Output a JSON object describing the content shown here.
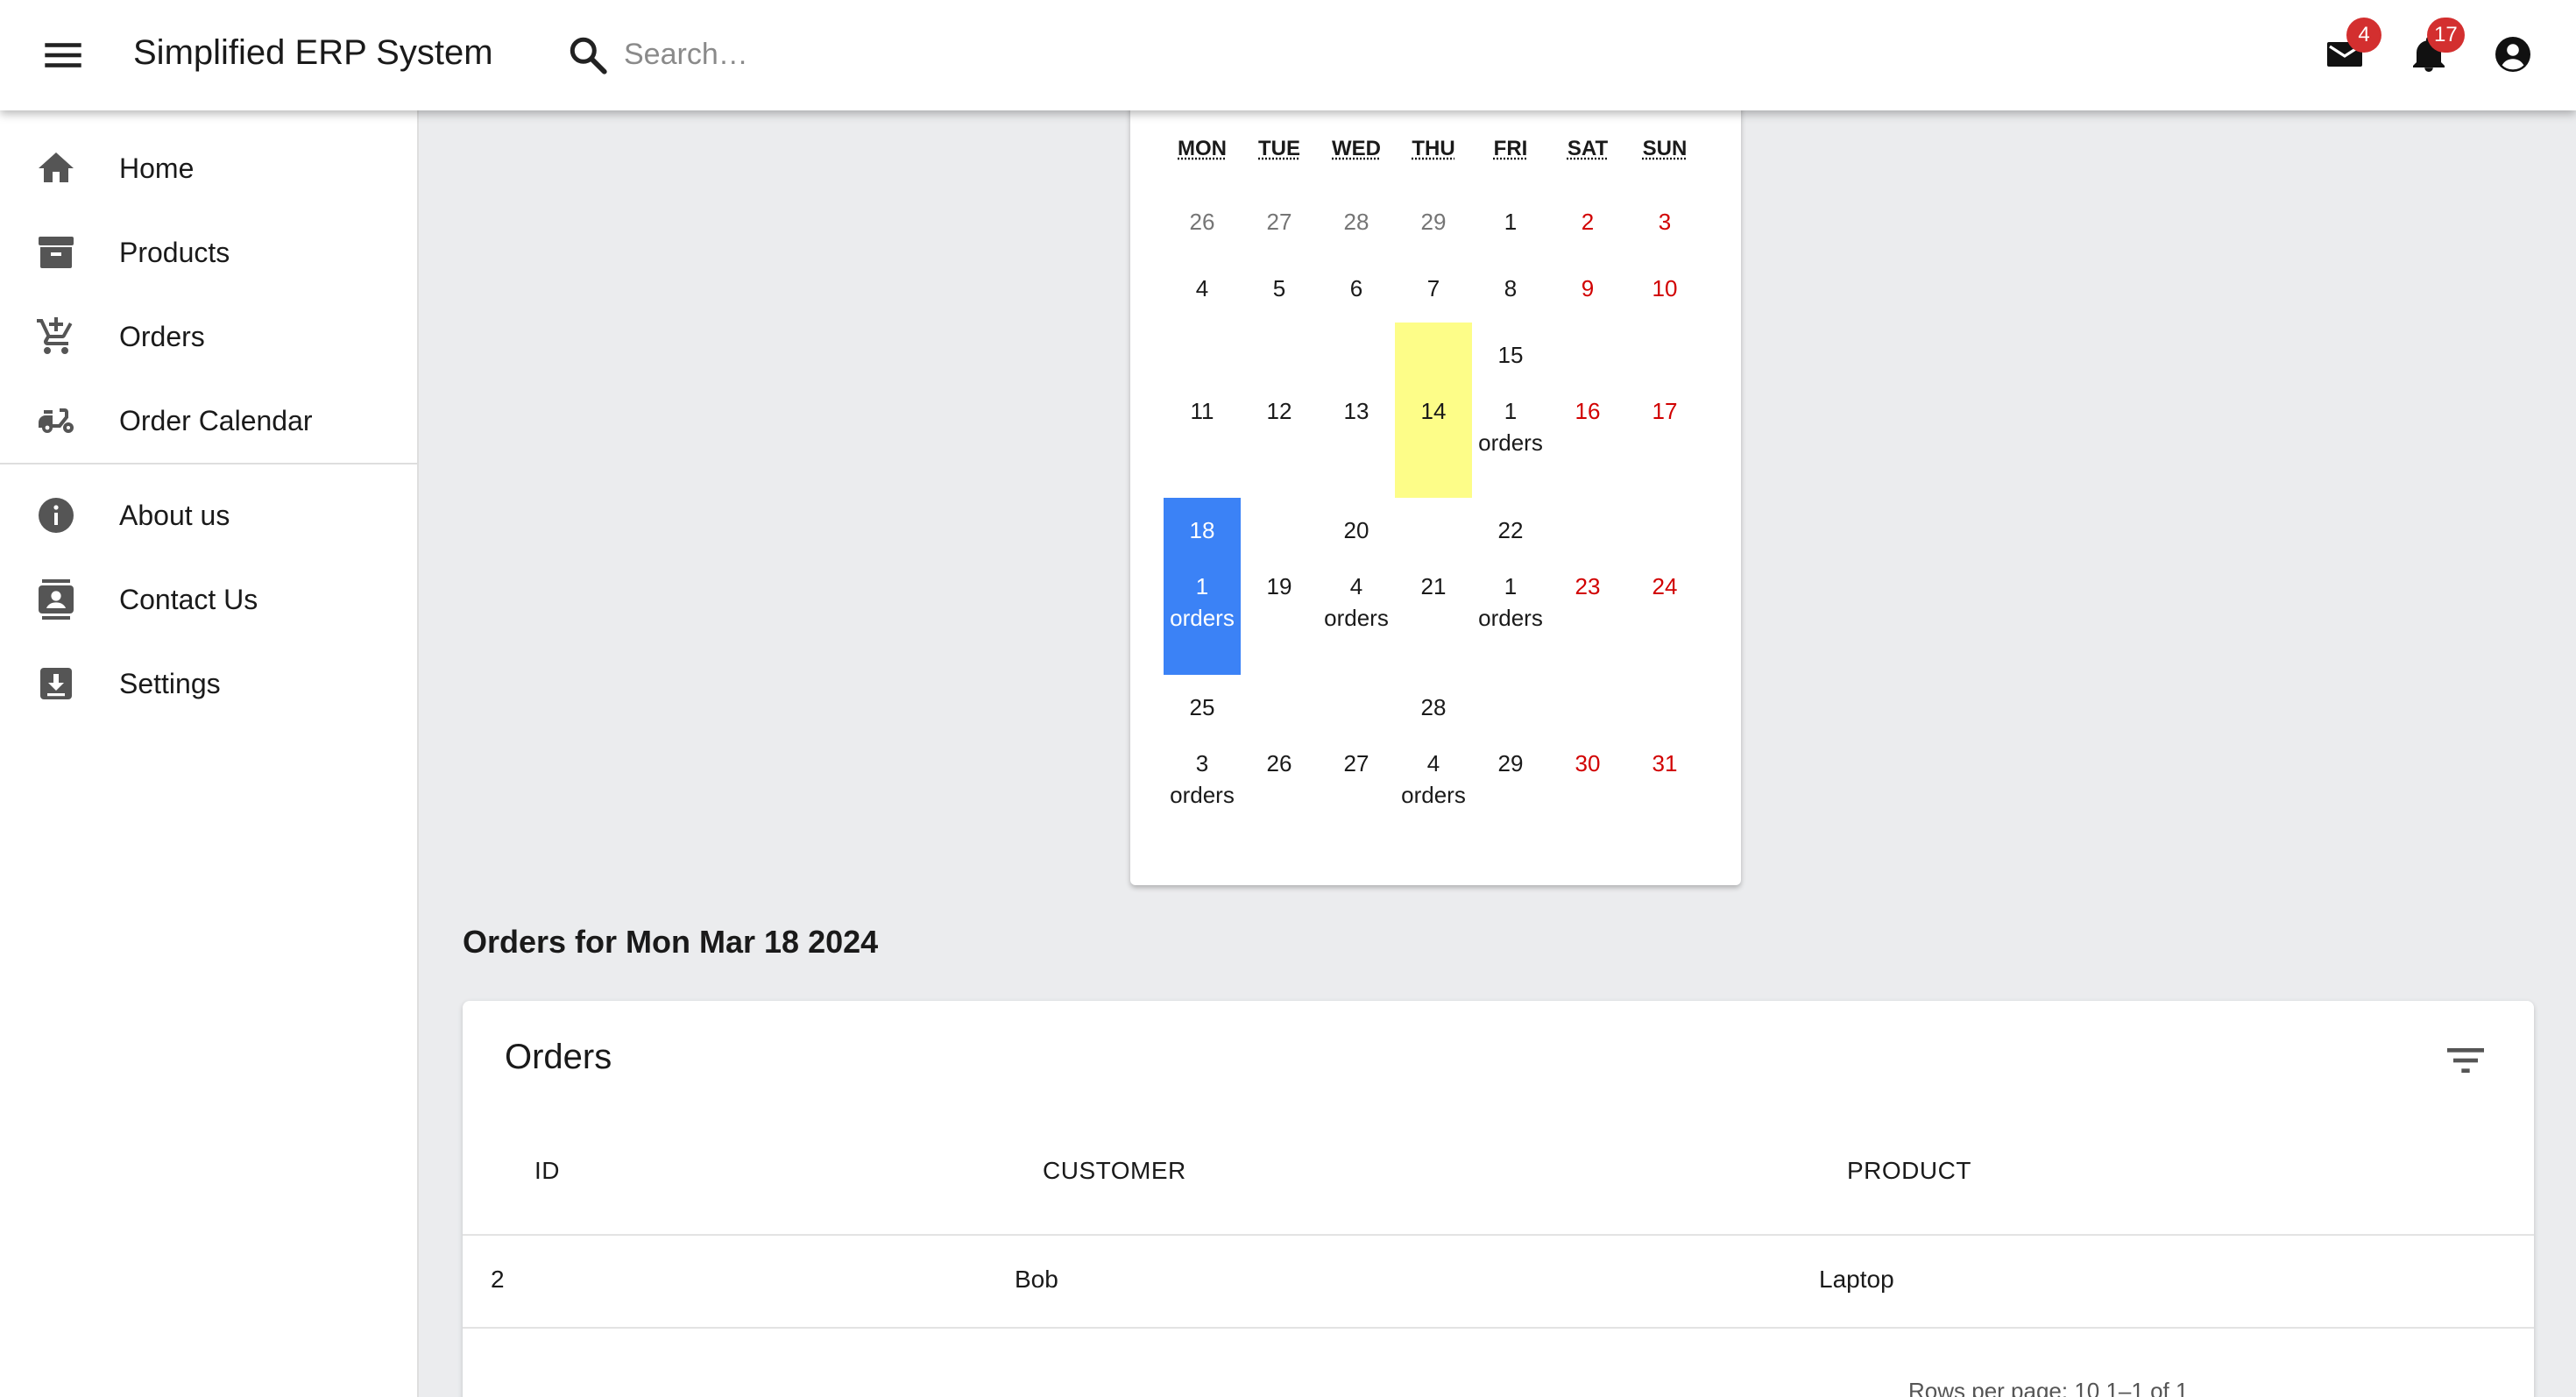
{
  "appbar": {
    "title": "Simplified ERP System",
    "search_placeholder": "Search…",
    "mail_badge": "4",
    "notifications_badge": "17",
    "icons": [
      "menu-icon",
      "search-icon",
      "mail-icon",
      "bell-icon",
      "account-circle-icon"
    ]
  },
  "sidebar": {
    "items": [
      {
        "label": "Home",
        "icon": "home-icon"
      },
      {
        "label": "Products",
        "icon": "archive-box-icon"
      },
      {
        "label": "Orders",
        "icon": "cart-add-icon"
      },
      {
        "label": "Order Calendar",
        "icon": "delivery-scooter-icon"
      },
      {
        "label": "About us",
        "icon": "info-icon"
      },
      {
        "label": "Contact Us",
        "icon": "contact-card-icon"
      },
      {
        "label": "Settings",
        "icon": "download-box-icon"
      }
    ]
  },
  "calendar": {
    "weekdays": [
      "MON",
      "TUE",
      "WED",
      "THU",
      "FRI",
      "SAT",
      "SUN"
    ],
    "orders_word": "orders",
    "weeks": [
      [
        {
          "day": "26",
          "kind": "neighbor"
        },
        {
          "day": "27",
          "kind": "neighbor"
        },
        {
          "day": "28",
          "kind": "neighbor"
        },
        {
          "day": "29",
          "kind": "neighbor"
        },
        {
          "day": "1",
          "kind": "normal"
        },
        {
          "day": "2",
          "kind": "weekend"
        },
        {
          "day": "3",
          "kind": "weekend"
        }
      ],
      [
        {
          "day": "4",
          "kind": "normal"
        },
        {
          "day": "5",
          "kind": "normal"
        },
        {
          "day": "6",
          "kind": "normal"
        },
        {
          "day": "7",
          "kind": "normal"
        },
        {
          "day": "8",
          "kind": "normal"
        },
        {
          "day": "9",
          "kind": "weekend"
        },
        {
          "day": "10",
          "kind": "weekend"
        }
      ],
      [
        {
          "day": "11",
          "kind": "normal"
        },
        {
          "day": "12",
          "kind": "normal"
        },
        {
          "day": "13",
          "kind": "normal"
        },
        {
          "day": "14",
          "kind": "today"
        },
        {
          "day": "15",
          "kind": "normal",
          "orders": "1"
        },
        {
          "day": "16",
          "kind": "weekend"
        },
        {
          "day": "17",
          "kind": "weekend"
        }
      ],
      [
        {
          "day": "18",
          "kind": "active",
          "orders": "1"
        },
        {
          "day": "19",
          "kind": "normal"
        },
        {
          "day": "20",
          "kind": "normal",
          "orders": "4"
        },
        {
          "day": "21",
          "kind": "normal"
        },
        {
          "day": "22",
          "kind": "normal",
          "orders": "1"
        },
        {
          "day": "23",
          "kind": "weekend"
        },
        {
          "day": "24",
          "kind": "weekend"
        }
      ],
      [
        {
          "day": "25",
          "kind": "normal",
          "orders": "3"
        },
        {
          "day": "26",
          "kind": "normal"
        },
        {
          "day": "27",
          "kind": "normal"
        },
        {
          "day": "28",
          "kind": "normal",
          "orders": "4"
        },
        {
          "day": "29",
          "kind": "normal"
        },
        {
          "day": "30",
          "kind": "weekend"
        },
        {
          "day": "31",
          "kind": "weekend"
        }
      ]
    ]
  },
  "orders_section": {
    "heading": "Orders for Mon Mar 18 2024",
    "table": {
      "title": "Orders",
      "columns": [
        "ID",
        "CUSTOMER",
        "PRODUCT"
      ],
      "rows": [
        {
          "id": "2",
          "customer": "Bob",
          "product": "Laptop"
        }
      ],
      "pagination_text": "Rows per page: 10    1–1 of 1"
    }
  },
  "colors": {
    "accent_blue": "#3b82f6",
    "today_yellow": "#fdfd88",
    "weekend_red": "#d10000",
    "badge_red": "#d32f2f"
  }
}
